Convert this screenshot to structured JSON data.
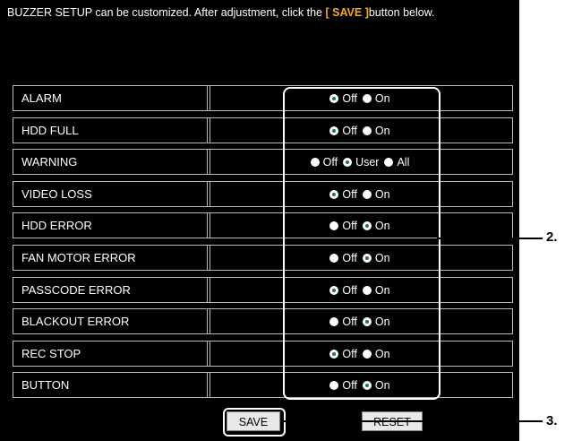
{
  "intro": {
    "text_before": "BUZZER SETUP can be customized. After adjustment, click the ",
    "highlight": "[ SAVE ]",
    "text_after": "button below."
  },
  "settings": [
    {
      "label": "ALARM",
      "options": [
        {
          "label": "Off",
          "selected": true
        },
        {
          "label": "On",
          "selected": false
        }
      ]
    },
    {
      "label": "HDD FULL",
      "options": [
        {
          "label": "Off",
          "selected": true
        },
        {
          "label": "On",
          "selected": false
        }
      ]
    },
    {
      "label": "WARNING",
      "options": [
        {
          "label": "Off",
          "selected": false
        },
        {
          "label": "User",
          "selected": true
        },
        {
          "label": "All",
          "selected": false
        }
      ]
    },
    {
      "label": "VIDEO LOSS",
      "options": [
        {
          "label": "Off",
          "selected": true
        },
        {
          "label": "On",
          "selected": false
        }
      ]
    },
    {
      "label": "HDD ERROR",
      "options": [
        {
          "label": "Off",
          "selected": false
        },
        {
          "label": "On",
          "selected": true
        }
      ]
    },
    {
      "label": "FAN MOTOR ERROR",
      "options": [
        {
          "label": "Off",
          "selected": false
        },
        {
          "label": "On",
          "selected": true
        }
      ]
    },
    {
      "label": "PASSCODE ERROR",
      "options": [
        {
          "label": "Off",
          "selected": true
        },
        {
          "label": "On",
          "selected": false
        }
      ]
    },
    {
      "label": "BLACKOUT ERROR",
      "options": [
        {
          "label": "Off",
          "selected": false
        },
        {
          "label": "On",
          "selected": true
        }
      ]
    },
    {
      "label": "REC STOP",
      "options": [
        {
          "label": "Off",
          "selected": true
        },
        {
          "label": "On",
          "selected": false
        }
      ]
    },
    {
      "label": "BUTTON",
      "options": [
        {
          "label": "Off",
          "selected": false
        },
        {
          "label": "On",
          "selected": true
        }
      ]
    }
  ],
  "buttons": {
    "save": "SAVE",
    "reset": "RESET"
  },
  "callouts": {
    "options": "2.",
    "save": "3."
  },
  "colors": {
    "background": "#000000",
    "highlight": "#f5a623",
    "radio_dot": "#1f7a3a"
  }
}
